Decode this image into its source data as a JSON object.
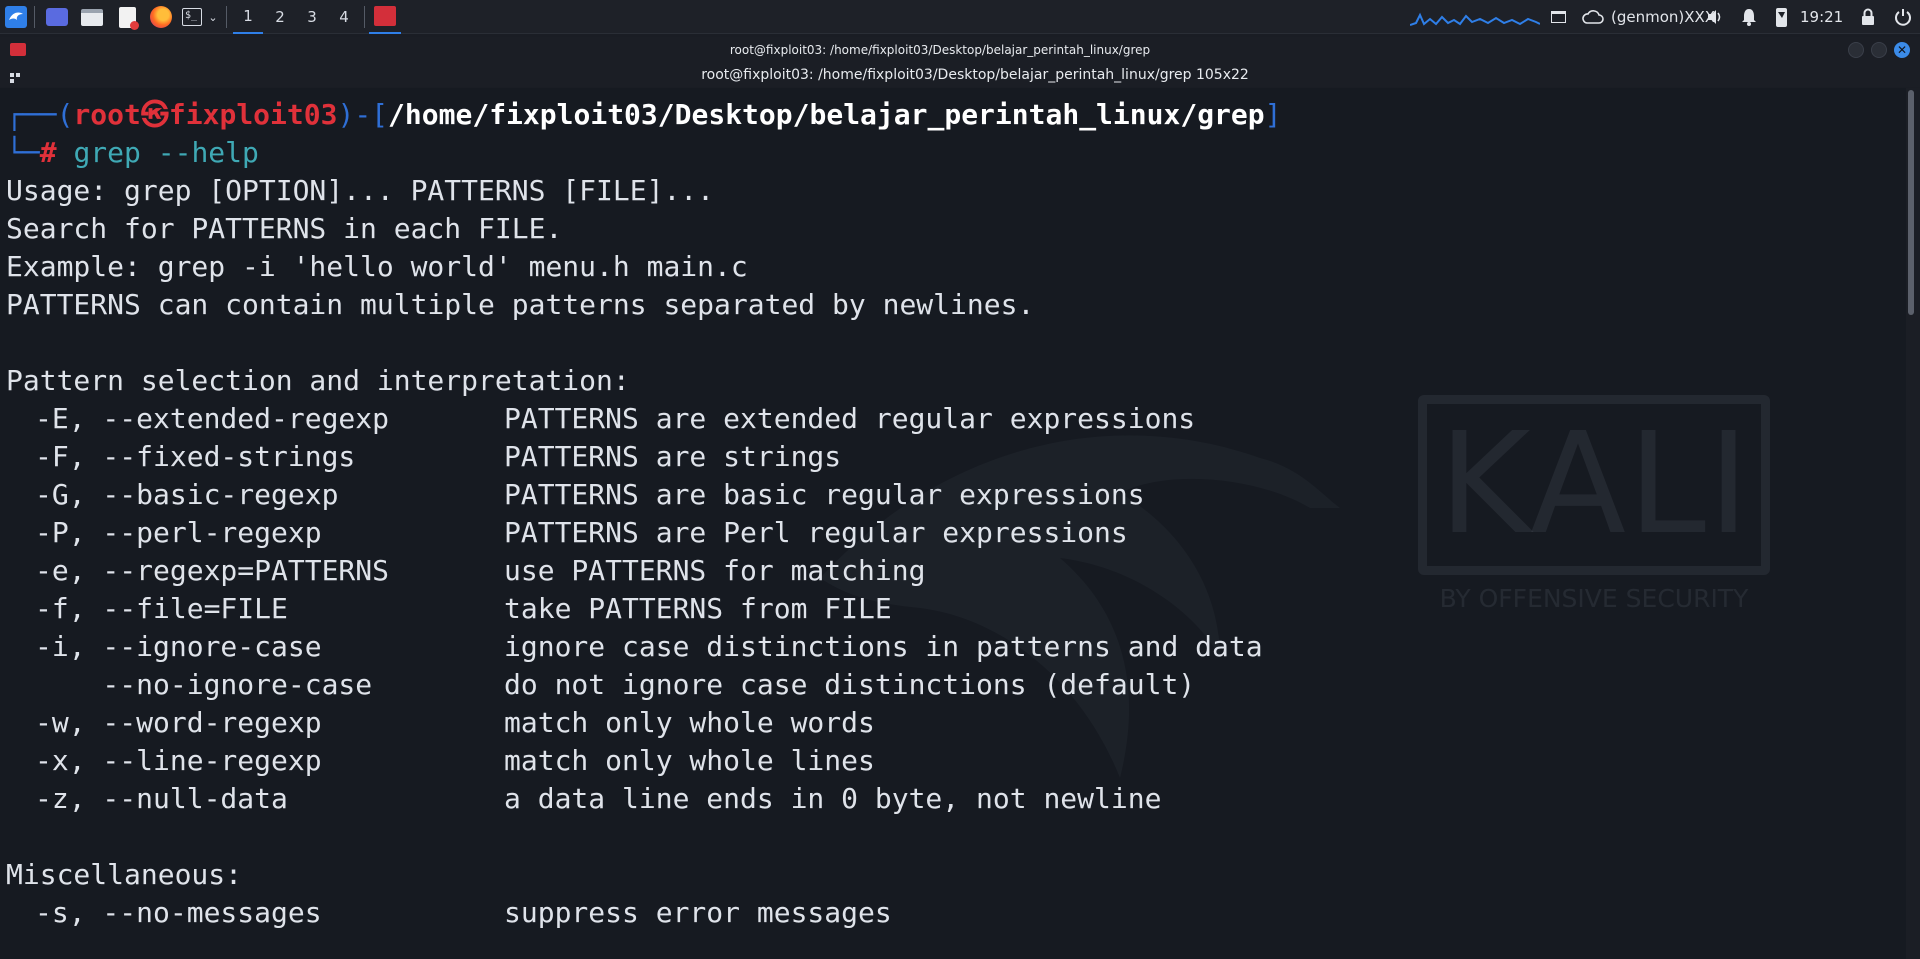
{
  "panel": {
    "workspaces": [
      "1",
      "2",
      "3",
      "4"
    ],
    "active_workspace": "1",
    "tray": {
      "genmon": "(genmon)XXX",
      "clock": "19:21"
    }
  },
  "window": {
    "title": "root@fixploit03: /home/fixploit03/Desktop/belajar_perintah_linux/grep",
    "tab_title": "root@fixploit03: /home/fixploit03/Desktop/belajar_perintah_linux/grep 105x22"
  },
  "terminal": {
    "prompt": {
      "user": "root",
      "at_symbol": "㉿",
      "host": "fixploit03",
      "path": "/home/fixploit03/Desktop/belajar_perintah_linux/grep",
      "hash": "#",
      "command": "grep --help"
    },
    "intro_lines": [
      "Usage: grep [OPTION]... PATTERNS [FILE]...",
      "Search for PATTERNS in each FILE.",
      "Example: grep -i 'hello world' menu.h main.c",
      "PATTERNS can contain multiple patterns separated by newlines."
    ],
    "section1": "Pattern selection and interpretation:",
    "options": [
      {
        "flag": "-E, --extended-regexp",
        "desc": "PATTERNS are extended regular expressions"
      },
      {
        "flag": "-F, --fixed-strings",
        "desc": "PATTERNS are strings"
      },
      {
        "flag": "-G, --basic-regexp",
        "desc": "PATTERNS are basic regular expressions"
      },
      {
        "flag": "-P, --perl-regexp",
        "desc": "PATTERNS are Perl regular expressions"
      },
      {
        "flag": "-e, --regexp=PATTERNS",
        "desc": "use PATTERNS for matching"
      },
      {
        "flag": "-f, --file=FILE",
        "desc": "take PATTERNS from FILE"
      },
      {
        "flag": "-i, --ignore-case",
        "desc": "ignore case distinctions in patterns and data"
      },
      {
        "flag": "    --no-ignore-case",
        "desc": "do not ignore case distinctions (default)"
      },
      {
        "flag": "-w, --word-regexp",
        "desc": "match only whole words"
      },
      {
        "flag": "-x, --line-regexp",
        "desc": "match only whole lines"
      },
      {
        "flag": "-z, --null-data",
        "desc": "a data line ends in 0 byte, not newline"
      }
    ],
    "section2": "Miscellaneous:",
    "misc_options": [
      {
        "flag": "-s, --no-messages",
        "desc": "suppress error messages"
      }
    ]
  },
  "wallpaper": {
    "logo": "KALI",
    "tagline": "BY OFFENSIVE SECURITY"
  },
  "colors": {
    "prompt_blue": "#2f6fd6",
    "prompt_red": "#e0313a",
    "command_teal": "#3fa9b5",
    "path_white": "#ffffff"
  }
}
